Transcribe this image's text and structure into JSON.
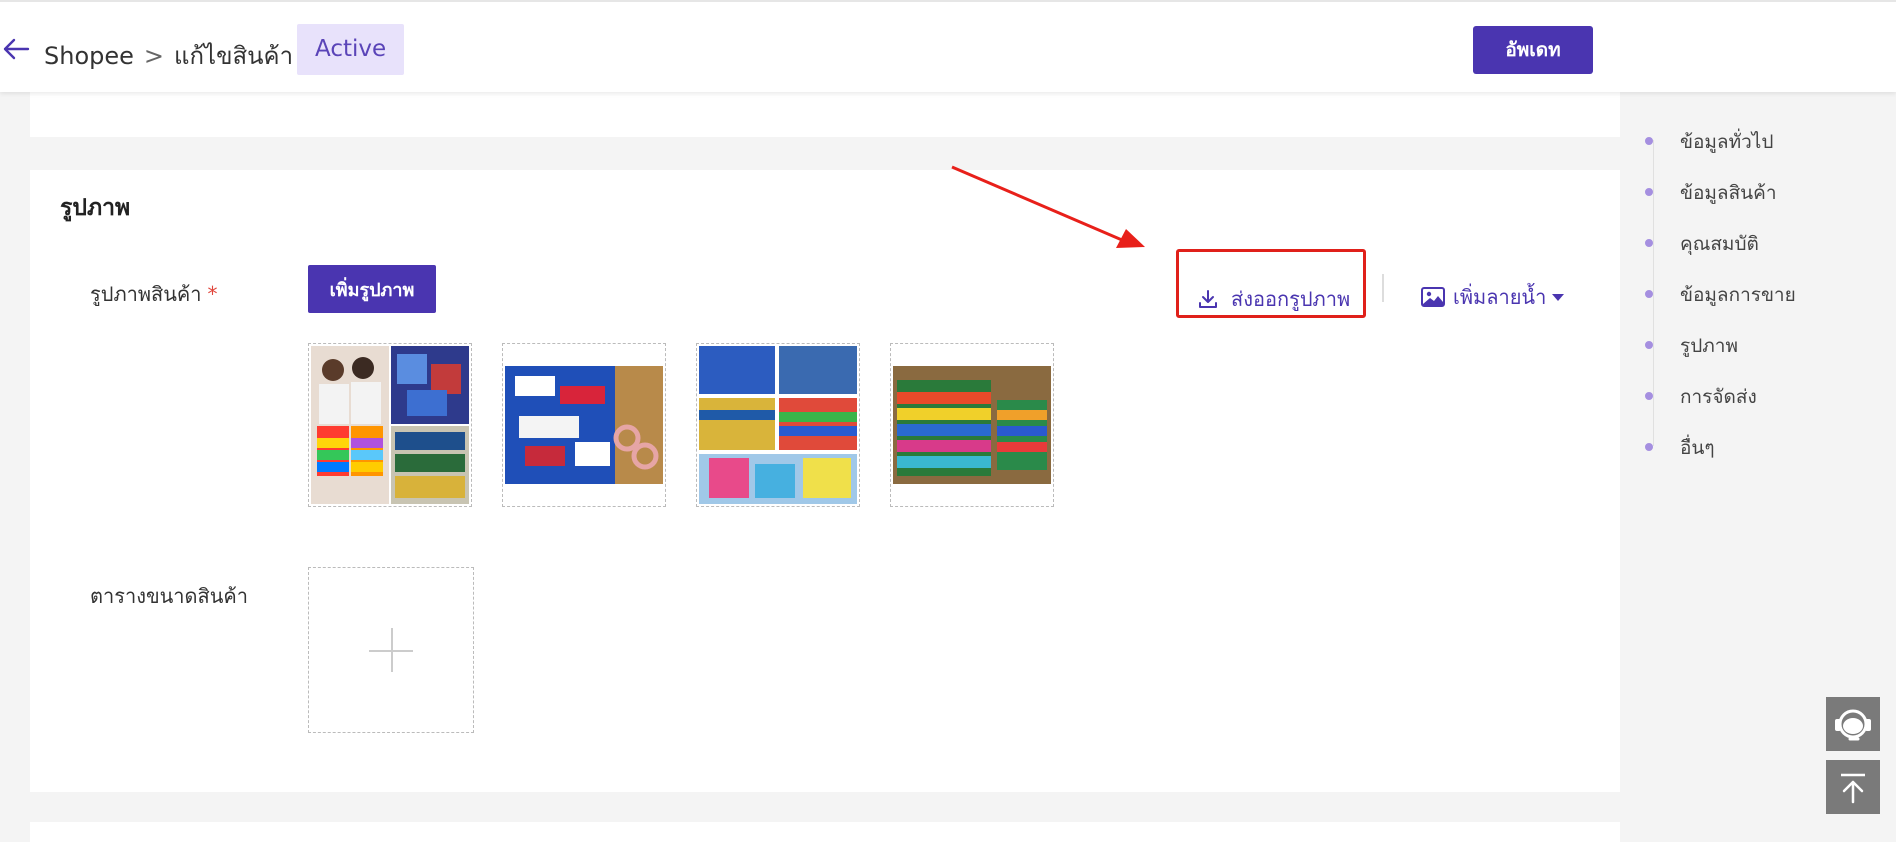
{
  "header": {
    "breadcrumb_root": "Shopee",
    "breadcrumb_sep": ">",
    "breadcrumb_current": "แก้ไขสินค้า",
    "status_badge": "Active",
    "update_label": "อัพเดท"
  },
  "images_section": {
    "title": "รูปภาพ",
    "product_images_label": "รูปภาพสินค้า",
    "required_mark": "*",
    "add_image_label": "เพิ่มรูปภาพ",
    "export_label": "ส่งออกรูปภาพ",
    "watermark_label": "เพิ่มลายน้ำ",
    "size_chart_label": "ตารางขนาดสินค้า"
  },
  "side_nav": {
    "items": [
      {
        "label": "ข้อมูลทั่วไป"
      },
      {
        "label": "ข้อมูลสินค้า"
      },
      {
        "label": "คุณสมบัติ"
      },
      {
        "label": "ข้อมูลการขาย"
      },
      {
        "label": "รูปภาพ"
      },
      {
        "label": "การจัดส่ง"
      },
      {
        "label": "อื่นๆ"
      }
    ]
  },
  "colors": {
    "accent": "#4a35b0",
    "highlight": "#e0201a",
    "nav_dot": "#a58fe0"
  },
  "icons": {
    "back": "arrow-left-icon",
    "export": "download-icon",
    "watermark": "image-icon",
    "support": "headset-icon",
    "top": "back-to-top-icon"
  }
}
